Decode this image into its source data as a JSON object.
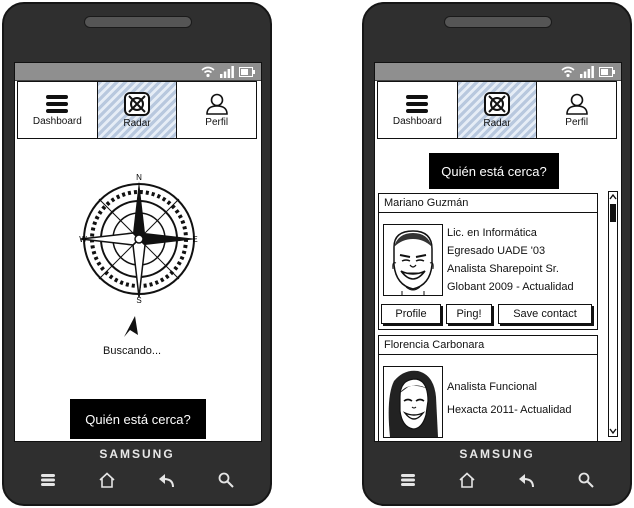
{
  "device_brand": "SAMSUNG",
  "tabs": [
    {
      "label": "Dashboard",
      "icon": "menu-icon"
    },
    {
      "label": "Radar",
      "icon": "radar-icon"
    },
    {
      "label": "Perfil",
      "icon": "user-icon"
    }
  ],
  "left_screen": {
    "compass_labels": {
      "n": "N",
      "s": "S",
      "e": "E",
      "w": "W"
    },
    "status_text": "Buscando...",
    "nearby_button": "Quién está cerca?"
  },
  "right_screen": {
    "nearby_button": "Quién está cerca?",
    "people": [
      {
        "name": "Mariano Guzmán",
        "lines": [
          "Lic. en Informática",
          "Egresado UADE '03",
          "Analista Sharepoint Sr.",
          "Globant 2009 - Actualidad"
        ],
        "buttons": {
          "profile": "Profile",
          "ping": "Ping!",
          "save": "Save contact"
        }
      },
      {
        "name": "Florencia Carbonara",
        "lines": [
          "Analista Funcional",
          "Hexacta 2011- Actualidad"
        ]
      }
    ]
  }
}
